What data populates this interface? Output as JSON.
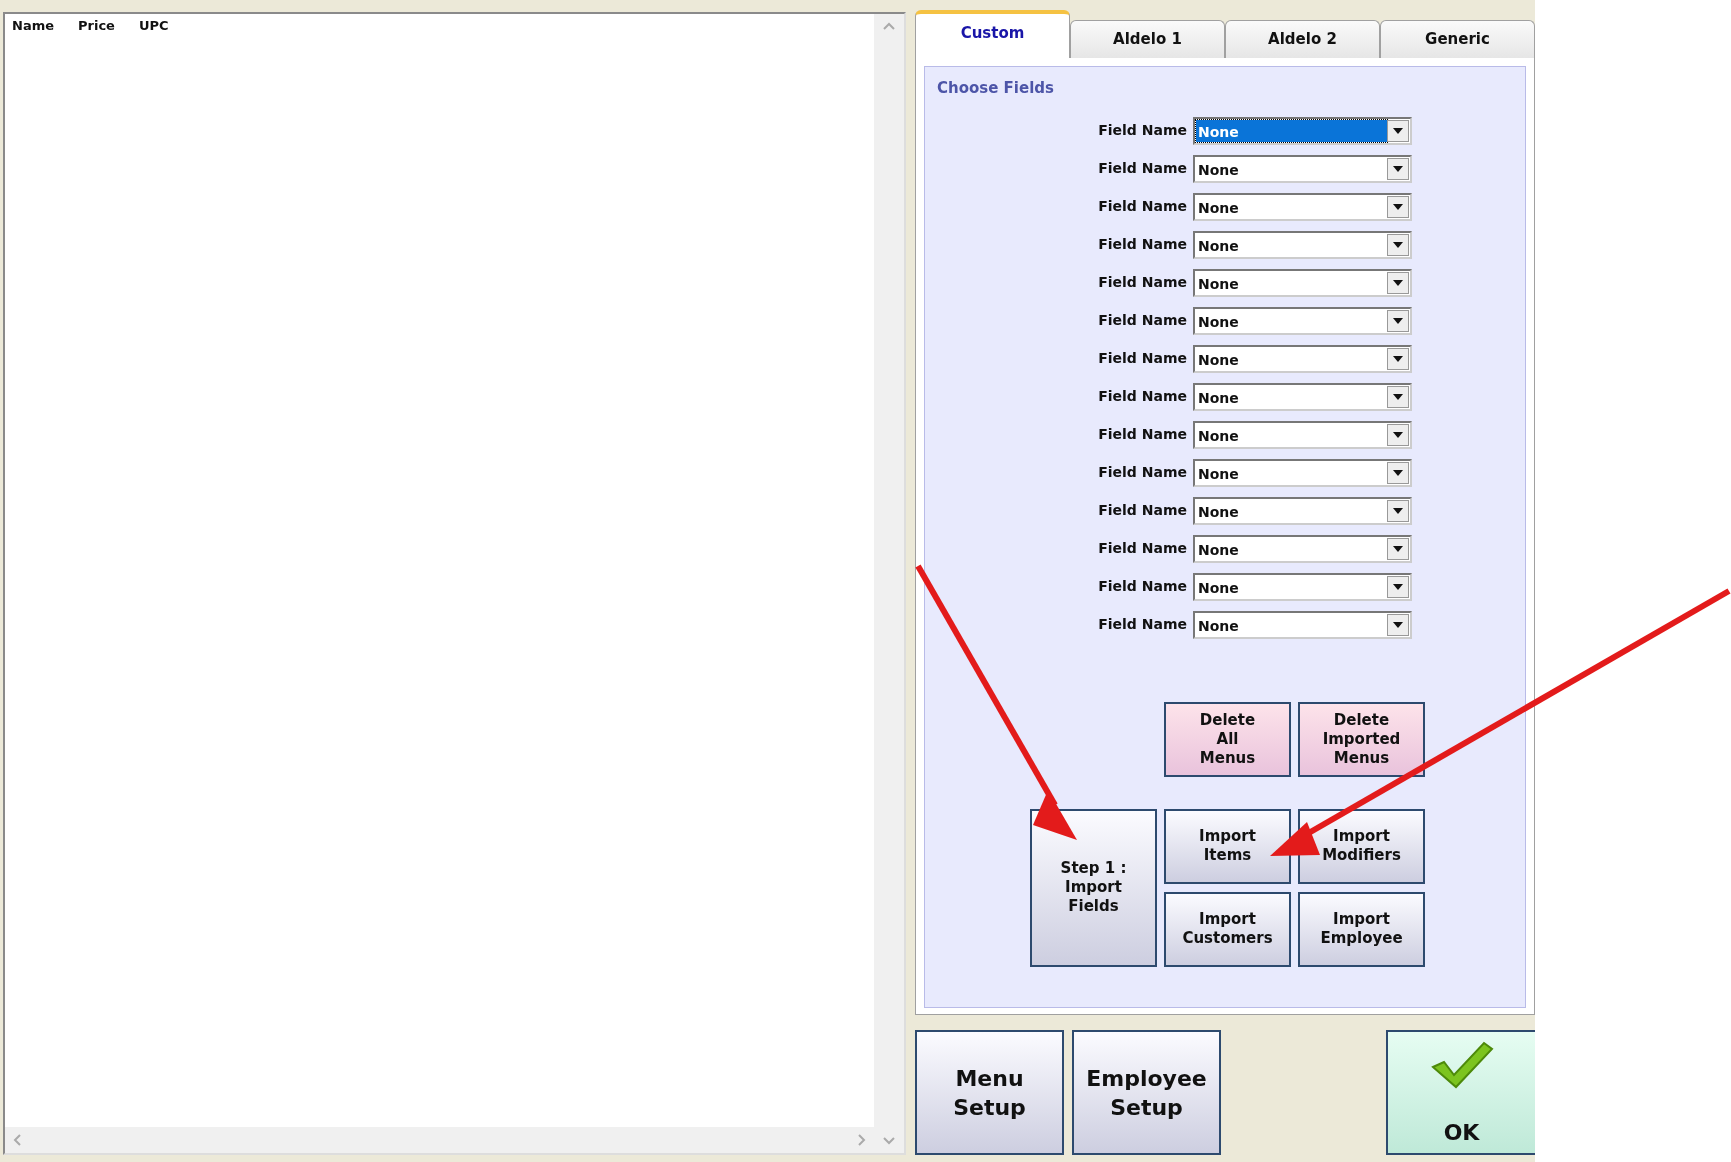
{
  "list": {
    "columns": [
      "Name",
      "Price",
      "UPC"
    ]
  },
  "tabs": [
    {
      "label": "Custom",
      "selected": true
    },
    {
      "label": "Aldelo 1",
      "selected": false
    },
    {
      "label": "Aldelo 2",
      "selected": false
    },
    {
      "label": "Generic",
      "selected": false
    }
  ],
  "group": {
    "title": "Choose Fields",
    "fields": [
      {
        "label": "Field Name",
        "value": "None",
        "selected": true
      },
      {
        "label": "Field Name",
        "value": "None",
        "selected": false
      },
      {
        "label": "Field Name",
        "value": "None",
        "selected": false
      },
      {
        "label": "Field Name",
        "value": "None",
        "selected": false
      },
      {
        "label": "Field Name",
        "value": "None",
        "selected": false
      },
      {
        "label": "Field Name",
        "value": "None",
        "selected": false
      },
      {
        "label": "Field Name",
        "value": "None",
        "selected": false
      },
      {
        "label": "Field Name",
        "value": "None",
        "selected": false
      },
      {
        "label": "Field Name",
        "value": "None",
        "selected": false
      },
      {
        "label": "Field Name",
        "value": "None",
        "selected": false
      },
      {
        "label": "Field Name",
        "value": "None",
        "selected": false
      },
      {
        "label": "Field Name",
        "value": "None",
        "selected": false
      },
      {
        "label": "Field Name",
        "value": "None",
        "selected": false
      },
      {
        "label": "Field Name",
        "value": "None",
        "selected": false
      }
    ]
  },
  "actions": [
    {
      "label": "Delete\nAll\nMenus",
      "kind": "danger"
    },
    {
      "label": "Delete\nImported\nMenus",
      "kind": "danger"
    },
    {
      "label": "Step 1 :\nImport\nFields",
      "kind": "step"
    },
    {
      "label": "Import\nItems",
      "kind": "normal"
    },
    {
      "label": "Import\nModifiers",
      "kind": "normal"
    },
    {
      "label": "Import\nCustomers",
      "kind": "normal"
    },
    {
      "label": "Import\nEmployee",
      "kind": "normal"
    }
  ],
  "footer_buttons": [
    {
      "label": "Menu\nSetup"
    },
    {
      "label": "Employee\nSetup"
    }
  ],
  "ok_button": {
    "label": "OK"
  }
}
